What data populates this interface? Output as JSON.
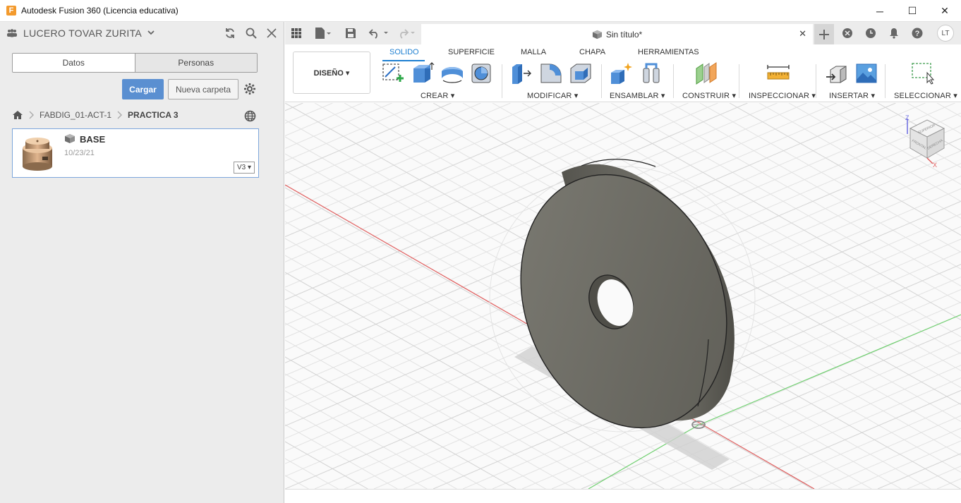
{
  "window": {
    "logo_letter": "F",
    "title": "Autodesk Fusion 360 (Licencia educativa)",
    "minimize": "─",
    "maximize": "☐",
    "close": "✕"
  },
  "data_panel": {
    "user": "LUCERO TOVAR ZURITA",
    "tabs": {
      "data": "Datos",
      "people": "Personas"
    },
    "upload_button": "Cargar",
    "new_folder_button": "Nueva carpeta",
    "breadcrumb": {
      "project": "FABDIG_01-ACT-1",
      "folder": "PRACTICA 3"
    },
    "file": {
      "name": "BASE",
      "date": "10/23/21",
      "version": "V3 ▾"
    }
  },
  "document": {
    "tab_title": "Sin título*",
    "close": "✕"
  },
  "user_badge": "LT",
  "ribbon": {
    "workspace": "DISEÑO ▾",
    "tabs": [
      "SOLIDO",
      "SUPERFICIE",
      "MALLA",
      "CHAPA",
      "HERRAMIENTAS"
    ],
    "groups": [
      "CREAR ▾",
      "MODIFICAR ▾",
      "ENSAMBLAR ▾",
      "CONSTRUIR ▾",
      "INSPECCIONAR ▾",
      "INSERTAR ▾",
      "SELECCIONAR ▾"
    ]
  },
  "viewcube": {
    "z": "Z",
    "x": "X",
    "front": "FRONTAL",
    "right": "DERECHA",
    "top": "SUPERIOR"
  },
  "colors": {
    "accent": "#1d7fd1",
    "primary_button": "#5a8fd1",
    "part_face": "#6b6b64",
    "axis_x": "#e05a5a",
    "axis_y": "#63c963"
  }
}
